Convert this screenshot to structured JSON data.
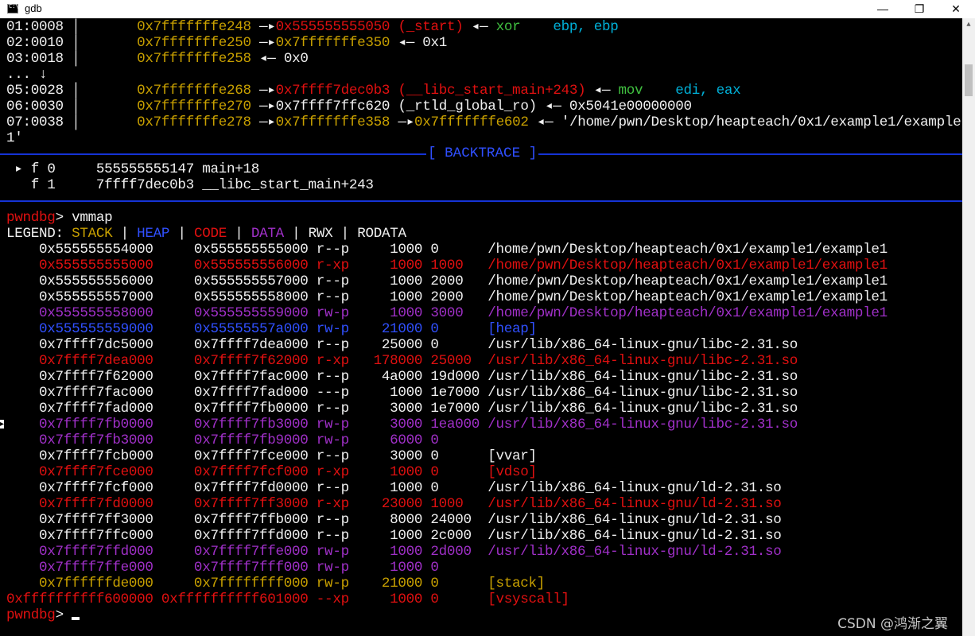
{
  "window": {
    "title": "gdb",
    "minimize": "—",
    "maximize": "❐",
    "close": "✕"
  },
  "colors": {
    "white": "#f0f0f0",
    "yellow": "#c8a000",
    "red": "#e01010",
    "purple": "#a030c8",
    "blue": "#3050ff",
    "cyan": "#00b0d8",
    "green": "#40c040",
    "grey": "#a0a0a0"
  },
  "stack": [
    [
      [
        "01:0008 │       ",
        "white"
      ],
      [
        "0x7fffffffe248 ",
        "yellow"
      ],
      [
        "—▸",
        "white"
      ],
      [
        "0x555555555050 (_start)",
        "red"
      ],
      [
        " ◂— ",
        "white"
      ],
      [
        "xor    ",
        "green"
      ],
      [
        "ebp, ebp",
        "cyan"
      ]
    ],
    [
      [
        "02:0010 │       ",
        "white"
      ],
      [
        "0x7fffffffe250 ",
        "yellow"
      ],
      [
        "—▸",
        "white"
      ],
      [
        "0x7fffffffe350 ",
        "yellow"
      ],
      [
        "◂— 0x1",
        "white"
      ]
    ],
    [
      [
        "03:0018 │       ",
        "white"
      ],
      [
        "0x7fffffffe258 ",
        "yellow"
      ],
      [
        "◂— 0x0",
        "white"
      ]
    ],
    [
      [
        "... ↓",
        "white"
      ]
    ],
    [
      [
        "05:0028 │       ",
        "white"
      ],
      [
        "0x7fffffffe268 ",
        "yellow"
      ],
      [
        "—▸",
        "white"
      ],
      [
        "0x7ffff7dec0b3 (__libc_start_main+243)",
        "red"
      ],
      [
        " ◂— ",
        "white"
      ],
      [
        "mov    ",
        "green"
      ],
      [
        "edi, eax",
        "cyan"
      ]
    ],
    [
      [
        "06:0030 │       ",
        "white"
      ],
      [
        "0x7fffffffe270 ",
        "yellow"
      ],
      [
        "—▸",
        "white"
      ],
      [
        "0x7ffff7ffc620 (_rtld_global_ro)",
        "white"
      ],
      [
        " ◂— 0x5041e00000000",
        "white"
      ]
    ],
    [
      [
        "07:0038 │       ",
        "white"
      ],
      [
        "0x7fffffffe278 ",
        "yellow"
      ],
      [
        "—▸",
        "white"
      ],
      [
        "0x7fffffffe358 ",
        "yellow"
      ],
      [
        "—▸",
        "white"
      ],
      [
        "0x7fffffffe602 ",
        "yellow"
      ],
      [
        "◂— '/home/pwn/Desktop/heapteach/0x1/example1/example",
        "white"
      ]
    ],
    [
      [
        "1'",
        "white"
      ]
    ]
  ],
  "backtrace_label": "[ BACKTRACE ]",
  "backtrace": [
    [
      [
        " ▸ f 0     555555555147 main+18",
        "white"
      ]
    ],
    [
      [
        "   f 1     7ffff7dec0b3 __libc_start_main+243",
        "white"
      ]
    ]
  ],
  "command": [
    [
      "pwndbg",
      "red"
    ],
    [
      "> vmmap",
      "white"
    ]
  ],
  "legend": [
    [
      "LEGEND: ",
      "white"
    ],
    [
      "STACK",
      "yellow"
    ],
    [
      " | ",
      "white"
    ],
    [
      "HEAP",
      "blue"
    ],
    [
      " | ",
      "white"
    ],
    [
      "CODE",
      "red"
    ],
    [
      " | ",
      "white"
    ],
    [
      "DATA",
      "purple"
    ],
    [
      " | ",
      "white"
    ],
    [
      "RWX",
      "white"
    ],
    [
      " | RODATA",
      "white"
    ]
  ],
  "vmmap": [
    [
      "    0x555555554000     0x555555555000 r--p     1000 0      /home/pwn/Desktop/heapteach/0x1/example1/example1",
      "white"
    ],
    [
      "    0x555555555000     0x555555556000 r-xp     1000 1000   /home/pwn/Desktop/heapteach/0x1/example1/example1",
      "red"
    ],
    [
      "    0x555555556000     0x555555557000 r--p     1000 2000   /home/pwn/Desktop/heapteach/0x1/example1/example1",
      "white"
    ],
    [
      "    0x555555557000     0x555555558000 r--p     1000 2000   /home/pwn/Desktop/heapteach/0x1/example1/example1",
      "white"
    ],
    [
      "    0x555555558000     0x555555559000 rw-p     1000 3000   /home/pwn/Desktop/heapteach/0x1/example1/example1",
      "purple"
    ],
    [
      "    0x555555559000     0x55555557a000 rw-p    21000 0      [heap]",
      "blue"
    ],
    [
      "    0x7ffff7dc5000     0x7ffff7dea000 r--p    25000 0      /usr/lib/x86_64-linux-gnu/libc-2.31.so",
      "white"
    ],
    [
      "    0x7ffff7dea000     0x7ffff7f62000 r-xp   178000 25000  /usr/lib/x86_64-linux-gnu/libc-2.31.so",
      "red"
    ],
    [
      "    0x7ffff7f62000     0x7ffff7fac000 r--p    4a000 19d000 /usr/lib/x86_64-linux-gnu/libc-2.31.so",
      "white"
    ],
    [
      "    0x7ffff7fac000     0x7ffff7fad000 ---p     1000 1e7000 /usr/lib/x86_64-linux-gnu/libc-2.31.so",
      "white"
    ],
    [
      "    0x7ffff7fad000     0x7ffff7fb0000 r--p     3000 1e7000 /usr/lib/x86_64-linux-gnu/libc-2.31.so",
      "white"
    ],
    [
      "    0x7ffff7fb0000     0x7ffff7fb3000 rw-p     3000 1ea000 /usr/lib/x86_64-linux-gnu/libc-2.31.so",
      "purple"
    ],
    [
      "    0x7ffff7fb3000     0x7ffff7fb9000 rw-p     6000 0",
      "purple"
    ],
    [
      "    0x7ffff7fcb000     0x7ffff7fce000 r--p     3000 0      [vvar]",
      "white"
    ],
    [
      "    0x7ffff7fce000     0x7ffff7fcf000 r-xp     1000 0      [vdso]",
      "red"
    ],
    [
      "    0x7ffff7fcf000     0x7ffff7fd0000 r--p     1000 0      /usr/lib/x86_64-linux-gnu/ld-2.31.so",
      "white"
    ],
    [
      "    0x7ffff7fd0000     0x7ffff7ff3000 r-xp    23000 1000   /usr/lib/x86_64-linux-gnu/ld-2.31.so",
      "red"
    ],
    [
      "    0x7ffff7ff3000     0x7ffff7ffb000 r--p     8000 24000  /usr/lib/x86_64-linux-gnu/ld-2.31.so",
      "white"
    ],
    [
      "    0x7ffff7ffc000     0x7ffff7ffd000 r--p     1000 2c000  /usr/lib/x86_64-linux-gnu/ld-2.31.so",
      "white"
    ],
    [
      "    0x7ffff7ffd000     0x7ffff7ffe000 rw-p     1000 2d000  /usr/lib/x86_64-linux-gnu/ld-2.31.so",
      "purple"
    ],
    [
      "    0x7ffff7ffe000     0x7ffff7fff000 rw-p     1000 0",
      "purple"
    ],
    [
      "    0x7ffffffde000     0x7ffffffff000 rw-p    21000 0      [stack]",
      "yellow"
    ],
    [
      "0xffffffffff600000 0xffffffffff601000 --xp     1000 0      [vsyscall]",
      "red"
    ]
  ],
  "prompt": [
    [
      "pwndbg",
      "red"
    ],
    [
      "> ",
      "white"
    ]
  ],
  "watermark": "CSDN @鸿渐之翼"
}
